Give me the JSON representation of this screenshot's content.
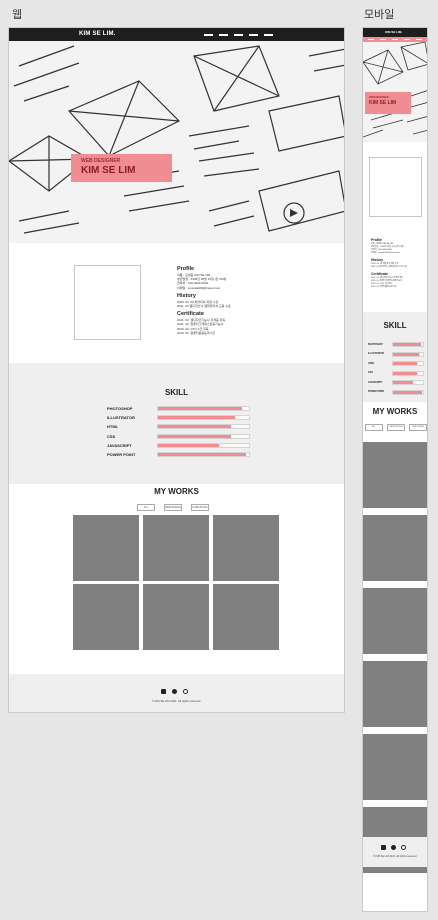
{
  "labels": {
    "web": "웹",
    "mobile": "모바일"
  },
  "site": {
    "logo": "KIM SE LIM.",
    "hero_sub": "WEB DESIGNER",
    "hero_name": "KIM SE LIM",
    "profile": {
      "title": "Profile",
      "lines": [
        "이름 : 김세림 KIM SE LIM",
        "생년월일 : 1995년 06월 15일 (만 25세)",
        "연락처 : 010-0000-0000",
        "이메일 : sunpala999@naver.com"
      ]
    },
    "history": {
      "title": "History",
      "lines": [
        "2020. 03. 00 퍼블리셔 과정 수강",
        "2021. 02 웹디자인 & 웹퍼블리셔 교육 수료"
      ]
    },
    "certificate": {
      "title": "Certificate",
      "lines": [
        "2021. 03. 웹디자인기능사 자격증 취득",
        "2021. 03. 컴퓨터그래픽스운용기능사",
        "2020. 02. GTQ 1급 취득",
        "2019. 03. 컴퓨터활용능력 2급"
      ]
    },
    "skill_title": "SKILL",
    "skills": [
      {
        "name": "PHOTOSHOP",
        "level": 0.92
      },
      {
        "name": "ILLUSTRATOR",
        "level": 0.85
      },
      {
        "name": "HTML",
        "level": 0.8
      },
      {
        "name": "CSS",
        "level": 0.8
      },
      {
        "name": "JAVASCRIPT",
        "level": 0.67
      },
      {
        "name": "POWER POINT",
        "level": 0.97
      }
    ],
    "works_title": "MY WORKS",
    "tabs": [
      "ALL",
      "WEB DESIGN",
      "PUBLISHING"
    ],
    "copyright": "© KIM SE LIM 2021. All rights reserved."
  },
  "icons": [
    "facebook-icon",
    "kakao-icon",
    "instagram-icon"
  ],
  "colors": {
    "accent": "#ef8d93",
    "dark": "#1e1e1e",
    "placeholder": "#808080"
  }
}
